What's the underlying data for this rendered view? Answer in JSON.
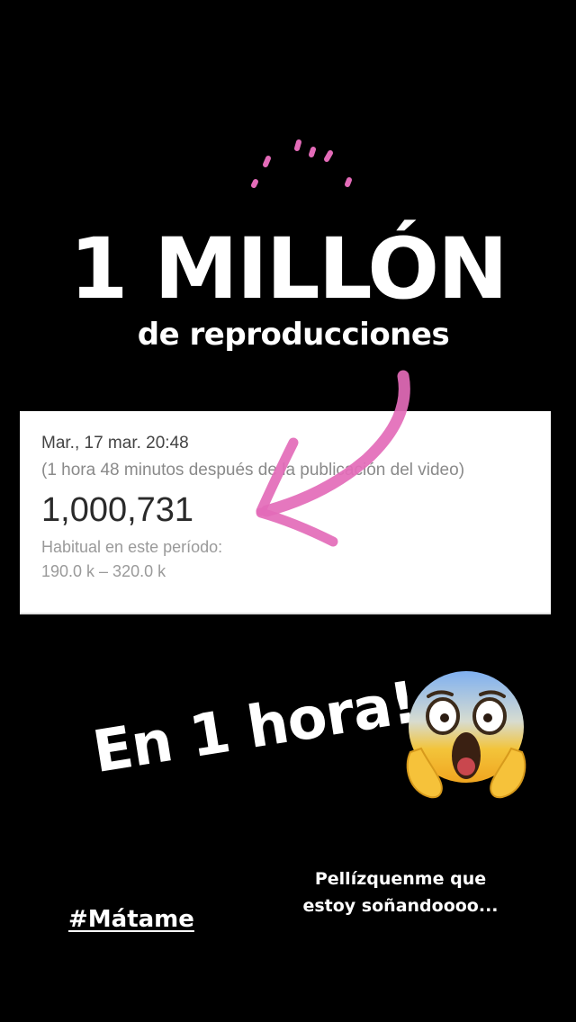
{
  "headline": {
    "title": "1 MILLÓN",
    "subtitle": "de reproducciones"
  },
  "stats_card": {
    "date": "Mar., 17 mar. 20:48",
    "note": "(1 hora 48 minutos después de la publicación del video)",
    "value": "1,000,731",
    "range_label": "Habitual en este período:",
    "range": "190.0 k – 320.0 k"
  },
  "overlay": {
    "time_text": "En 1 hora!",
    "caption": "Pellízquenme que estoy soñandoooo...",
    "hashtag": "#Mátame",
    "emoji": "face-screaming-in-fear-icon"
  },
  "colors": {
    "background": "#000000",
    "accent_pink": "#e36bb8",
    "card_bg": "#ffffff",
    "text": "#ffffff"
  }
}
